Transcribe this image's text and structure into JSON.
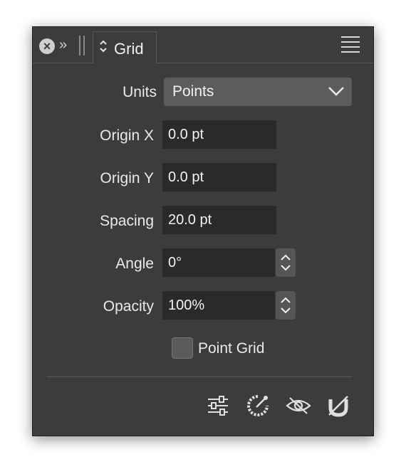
{
  "panel": {
    "tab_title": "Grid",
    "collapse_glyph": "»",
    "close_glyph": "×"
  },
  "form": {
    "units_label": "Units",
    "units_value": "Points",
    "origin_x_label": "Origin X",
    "origin_x_value": "0.0 pt",
    "origin_y_label": "Origin Y",
    "origin_y_value": "0.0 pt",
    "spacing_label": "Spacing",
    "spacing_value": "20.0 pt",
    "angle_label": "Angle",
    "angle_value": "0°",
    "opacity_label": "Opacity",
    "opacity_value": "100%",
    "point_grid_label": "Point Grid",
    "point_grid_checked": false
  },
  "toolbar": {
    "icons": [
      "sliders-icon",
      "color-wheel-icon",
      "eye-slash-icon",
      "magnet-off-icon"
    ]
  },
  "colors": {
    "panel_bg": "#3c3c3c",
    "field_bg": "#2a2a2a",
    "dropdown_bg": "#5c5c5c",
    "text": "#eaeaea"
  }
}
